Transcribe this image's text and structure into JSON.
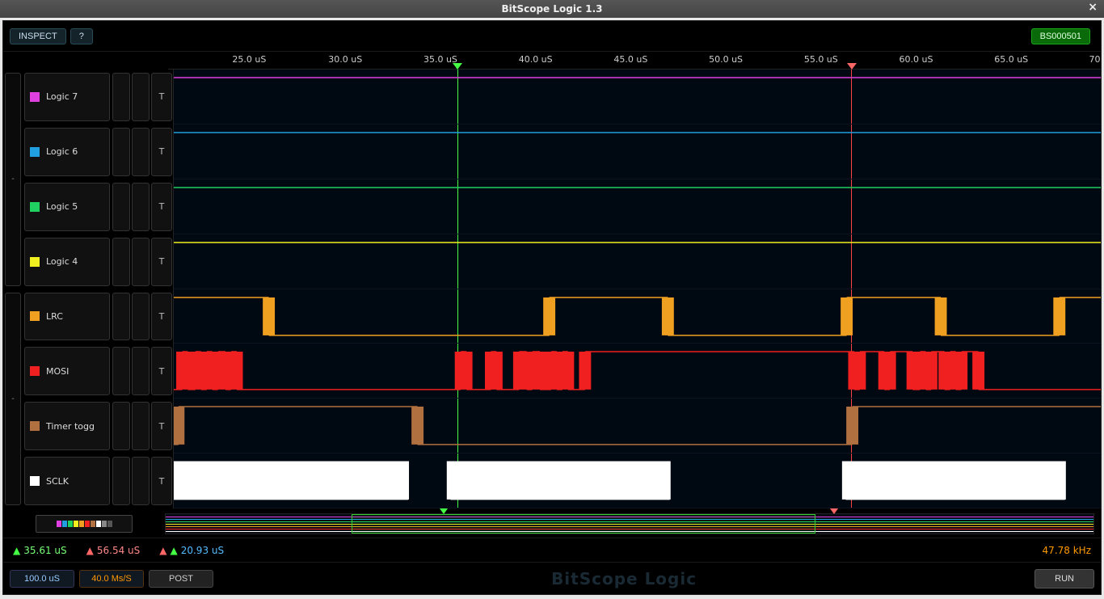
{
  "window": {
    "title": "BitScope Logic 1.3"
  },
  "toolbar": {
    "inspect": "INSPECT",
    "help": "?",
    "device_id": "BS000501"
  },
  "ruler": {
    "ticks": [
      "25.0 uS",
      "30.0 uS",
      "35.0 uS",
      "40.0 uS",
      "45.0 uS",
      "50.0 uS",
      "55.0 uS",
      "60.0 uS",
      "65.0 uS",
      "70."
    ],
    "positions_pct": [
      8.7,
      19,
      29.2,
      39.4,
      49.6,
      59.8,
      70,
      80.2,
      90.4,
      99.5
    ]
  },
  "groups": [
    "-",
    "-"
  ],
  "channels": [
    {
      "name": "Logic 7",
      "color": "#e040e0",
      "trig": "T"
    },
    {
      "name": "Logic 6",
      "color": "#20a0e0",
      "trig": "T"
    },
    {
      "name": "Logic 5",
      "color": "#20d060",
      "trig": "T"
    },
    {
      "name": "Logic 4",
      "color": "#f0f020",
      "trig": "T"
    },
    {
      "name": "LRC",
      "color": "#f0a020",
      "trig": "T"
    },
    {
      "name": "MOSI",
      "color": "#f02020",
      "trig": "T"
    },
    {
      "name": "Timer togg",
      "color": "#b07040",
      "trig": "T"
    },
    {
      "name": "SCLK",
      "color": "#ffffff",
      "trig": "T"
    }
  ],
  "cursors": {
    "green_pct": 30.6,
    "red_pct": 73.1
  },
  "status": {
    "green": "35.61 uS",
    "red": "56.54 uS",
    "delta": "20.93 uS",
    "freq": "47.78 kHz"
  },
  "footer": {
    "timebase": "100.0 uS",
    "samplerate": "40.0 Ms/S",
    "trigger_mode": "POST",
    "watermark": "BitScope Logic",
    "run": "RUN"
  },
  "palette_colors": [
    "#e040e0",
    "#20a0e0",
    "#20d060",
    "#f0f020",
    "#f0a020",
    "#f02020",
    "#b07040",
    "#ffffff",
    "#888",
    "#555"
  ],
  "chart_data": {
    "type": "logic-timing",
    "time_axis_us": {
      "start": 20.75,
      "end": 70.0
    },
    "cursors": {
      "green_us": 35.61,
      "red_us": 56.54,
      "delta_us": 20.93,
      "freq_khz": 47.78
    },
    "channels": {
      "Logic 7": {
        "constant": 1
      },
      "Logic 6": {
        "constant": 1
      },
      "Logic 5": {
        "constant": 1
      },
      "Logic 4": {
        "constant": 1
      },
      "LRC": {
        "initial": 1,
        "edges_us": [
          25.8,
          40.7,
          47.0,
          56.5,
          61.5,
          67.8
        ]
      },
      "MOSI": {
        "initial": 0,
        "note": "burst serial data pattern per SCLK frame",
        "edges_us": [
          21.2,
          21.5,
          21.9,
          22.2,
          22.5,
          22.8,
          23.1,
          23.5,
          23.8,
          24.1,
          36.0,
          36.3,
          37.6,
          37.9,
          39.1,
          39.5,
          39.8,
          40.2,
          40.8,
          41.1,
          41.4,
          41.7,
          42.6,
          56.9,
          57.2,
          58.5,
          58.8,
          60.0,
          60.4,
          60.7,
          61.0,
          61.7,
          62.0,
          62.3,
          62.6,
          63.5
        ]
      },
      "Timer togg": {
        "initial": 0,
        "edges_us": [
          21.0,
          33.7,
          56.8
        ]
      },
      "SCLK": {
        "type": "clock-bursts",
        "period_us": 0.4,
        "bursts_us": [
          [
            20.8,
            33.0
          ],
          [
            35.5,
            47.0
          ],
          [
            56.5,
            68.0
          ]
        ]
      }
    }
  }
}
